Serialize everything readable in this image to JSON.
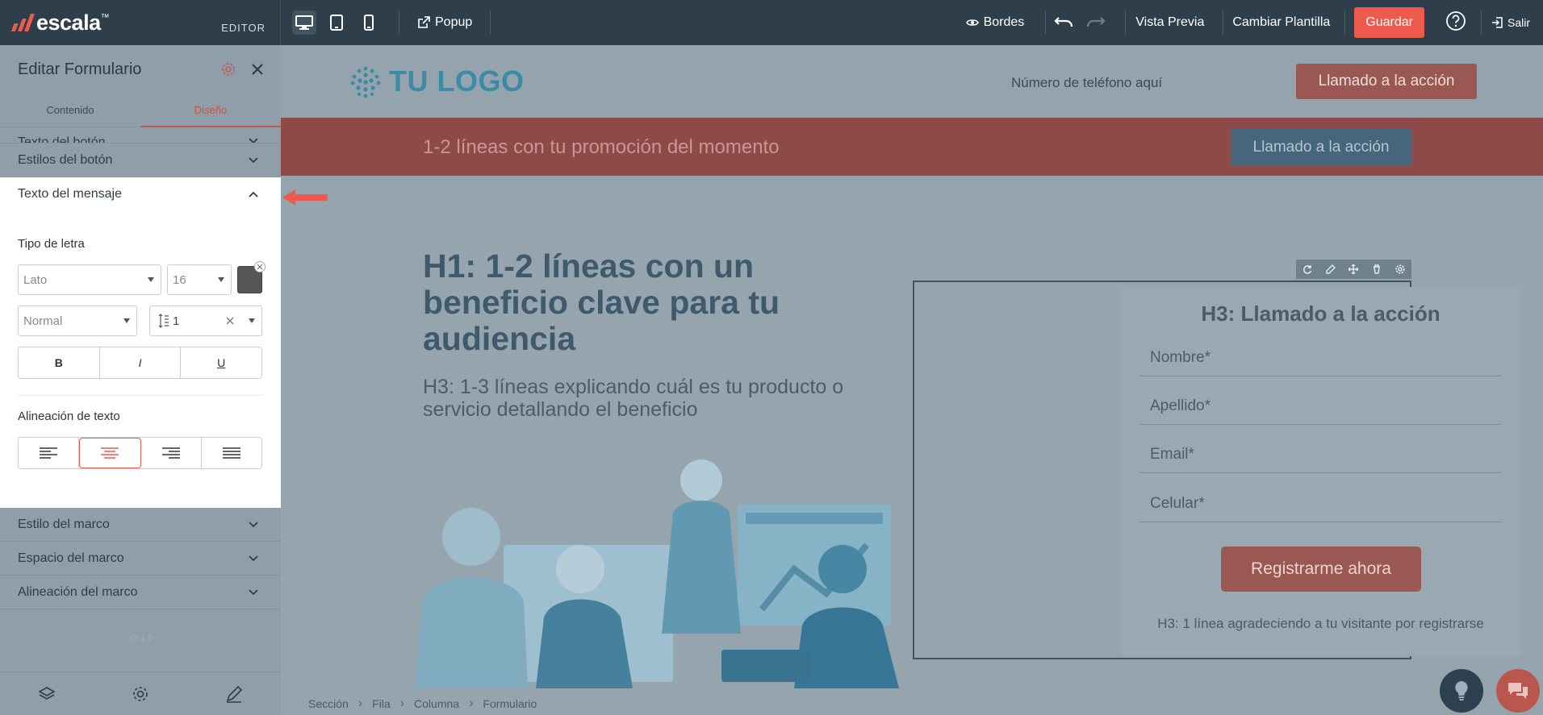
{
  "topbar": {
    "brand": "escala",
    "brand_tm": "™",
    "editor_label": "EDITOR",
    "popup_label": "Popup",
    "borders_label": "Bordes",
    "preview_label": "Vista Previa",
    "change_template_label": "Cambiar Plantilla",
    "save_label": "Guardar",
    "exit_label": "Salir"
  },
  "sidebar": {
    "title": "Editar Formulario",
    "tabs": [
      "Contenido",
      "Diseño"
    ],
    "active_tab": "Diseño",
    "sections_above": [
      "Texto del botón",
      "Estilos del botón"
    ],
    "open_section": "Texto del mensaje",
    "font_label": "Tipo de letra",
    "font_family": "Lato",
    "font_size": "16",
    "font_weight": "Normal",
    "line_height": "1",
    "bold": "B",
    "italic": "I",
    "underline": "U",
    "align_label": "Alineación de texto",
    "align_selected": "center",
    "sections_below": [
      "Estilo del marco",
      "Espacio del marco",
      "Alineación del marco"
    ],
    "version": "v0.1.0",
    "text_color": "#555555"
  },
  "canvas": {
    "logo_text": "TU LOGO",
    "phone": "Número de teléfono aquí",
    "cta_top": "Llamado a la acción",
    "promo_text": "1-2 líneas con tu promoción del momento",
    "cta_promo": "Llamado a la acción",
    "h1": "H1: 1-2 líneas con un beneficio clave para tu audiencia",
    "h3": "H3: 1-3 líneas explicando cuál es tu producto o servicio detallando el beneficio",
    "form": {
      "title": "H3: Llamado a la acción",
      "fields": [
        "Nombre*",
        "Apellido*",
        "Email*",
        "Celular*"
      ],
      "button": "Registrarme ahora",
      "thanks": "H3: 1 línea agradeciendo a tu visitante por registrarse"
    },
    "breadcrumb": [
      "Sección",
      "Fila",
      "Columna",
      "Formulario"
    ]
  },
  "colors": {
    "accent": "#ee5a4d",
    "topbar": "#2e3f4b",
    "logo": "#3c8aa6"
  }
}
